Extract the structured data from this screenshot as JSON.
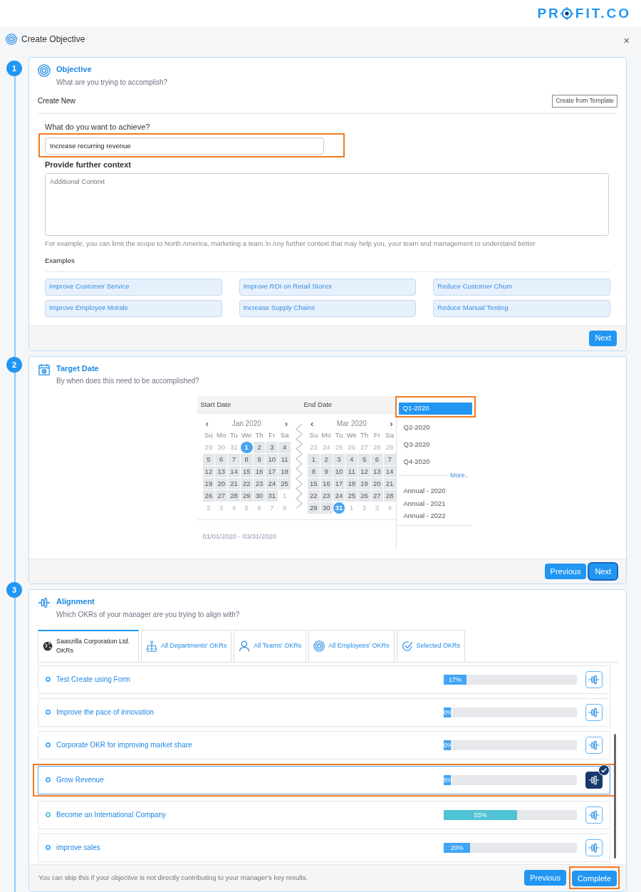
{
  "logo": {
    "before": "PR",
    "after": "FIT.CO"
  },
  "dialog": {
    "title": "Create Objective",
    "close": "×"
  },
  "objective": {
    "step": "1",
    "title": "Objective",
    "subtitle": "What are you trying to accomplish?",
    "create_new": "Create New",
    "template_button": "Create from Template",
    "goal_label": "What do you want to achieve?",
    "goal_value": "Increase recurring revenue",
    "goal_highlighted": true,
    "context_label": "Provide further context",
    "context_placeholder": "Additional Context",
    "hint": "For example, you can limit the scope to North America, marketing a team.\\n Any further context that may help you, your team and management to understand better",
    "examples_label": "Examples",
    "examples": [
      "Improve Customer Service",
      "Improve ROI on Retail Stores",
      "Reduce Customer Churn",
      "Improve Employee Morale",
      "Increase Supply Chains",
      "Reduce Manual Testing"
    ],
    "next": "Next"
  },
  "target_date": {
    "step": "2",
    "title": "Target Date",
    "subtitle": "By when does this need to be accomplished?",
    "start_label": "Start Date",
    "end_label": "End Date",
    "months": [
      {
        "title": "Jan 2020",
        "prev": "‹",
        "next": "›",
        "weekdays": [
          "Su",
          "Mo",
          "Tu",
          "We",
          "Th",
          "Fr",
          "Sa"
        ],
        "weeks": [
          [
            {
              "d": "29",
              "kind": "out"
            },
            {
              "d": "30",
              "kind": "out"
            },
            {
              "d": "31",
              "kind": "out"
            },
            {
              "d": "1",
              "kind": "selected"
            },
            {
              "d": "2",
              "kind": "range"
            },
            {
              "d": "3",
              "kind": "range"
            },
            {
              "d": "4",
              "kind": "range"
            }
          ],
          [
            {
              "d": "5",
              "kind": "range"
            },
            {
              "d": "6",
              "kind": "range"
            },
            {
              "d": "7",
              "kind": "range"
            },
            {
              "d": "8",
              "kind": "range"
            },
            {
              "d": "9",
              "kind": "range"
            },
            {
              "d": "10",
              "kind": "range"
            },
            {
              "d": "11",
              "kind": "range"
            }
          ],
          [
            {
              "d": "12",
              "kind": "range"
            },
            {
              "d": "13",
              "kind": "range"
            },
            {
              "d": "14",
              "kind": "range"
            },
            {
              "d": "15",
              "kind": "range"
            },
            {
              "d": "16",
              "kind": "range"
            },
            {
              "d": "17",
              "kind": "range"
            },
            {
              "d": "18",
              "kind": "range"
            }
          ],
          [
            {
              "d": "19",
              "kind": "range"
            },
            {
              "d": "20",
              "kind": "range"
            },
            {
              "d": "21",
              "kind": "range"
            },
            {
              "d": "22",
              "kind": "range"
            },
            {
              "d": "23",
              "kind": "range"
            },
            {
              "d": "24",
              "kind": "range"
            },
            {
              "d": "25",
              "kind": "range"
            }
          ],
          [
            {
              "d": "26",
              "kind": "range"
            },
            {
              "d": "27",
              "kind": "range"
            },
            {
              "d": "28",
              "kind": "range"
            },
            {
              "d": "29",
              "kind": "range"
            },
            {
              "d": "30",
              "kind": "range"
            },
            {
              "d": "31",
              "kind": "range"
            },
            {
              "d": "1",
              "kind": "out"
            }
          ],
          [
            {
              "d": "2",
              "kind": "out"
            },
            {
              "d": "3",
              "kind": "out"
            },
            {
              "d": "4",
              "kind": "out"
            },
            {
              "d": "5",
              "kind": "out"
            },
            {
              "d": "6",
              "kind": "out"
            },
            {
              "d": "7",
              "kind": "out"
            },
            {
              "d": "8",
              "kind": "out"
            }
          ]
        ]
      },
      {
        "title": "Mar 2020",
        "prev": "‹",
        "next": "›",
        "weekdays": [
          "Su",
          "Mo",
          "Tu",
          "We",
          "Th",
          "Fr",
          "Sa"
        ],
        "weeks": [
          [
            {
              "d": "23",
              "kind": "out"
            },
            {
              "d": "24",
              "kind": "out"
            },
            {
              "d": "25",
              "kind": "out"
            },
            {
              "d": "26",
              "kind": "out"
            },
            {
              "d": "27",
              "kind": "out"
            },
            {
              "d": "28",
              "kind": "out"
            },
            {
              "d": "29",
              "kind": "out"
            }
          ],
          [
            {
              "d": "1",
              "kind": "range"
            },
            {
              "d": "2",
              "kind": "range"
            },
            {
              "d": "3",
              "kind": "range"
            },
            {
              "d": "4",
              "kind": "range"
            },
            {
              "d": "5",
              "kind": "range"
            },
            {
              "d": "6",
              "kind": "range"
            },
            {
              "d": "7",
              "kind": "range"
            }
          ],
          [
            {
              "d": "8",
              "kind": "range"
            },
            {
              "d": "9",
              "kind": "range"
            },
            {
              "d": "10",
              "kind": "range"
            },
            {
              "d": "11",
              "kind": "range"
            },
            {
              "d": "12",
              "kind": "range"
            },
            {
              "d": "13",
              "kind": "range"
            },
            {
              "d": "14",
              "kind": "range"
            }
          ],
          [
            {
              "d": "15",
              "kind": "range"
            },
            {
              "d": "16",
              "kind": "range"
            },
            {
              "d": "17",
              "kind": "range"
            },
            {
              "d": "18",
              "kind": "range"
            },
            {
              "d": "19",
              "kind": "range"
            },
            {
              "d": "20",
              "kind": "range"
            },
            {
              "d": "21",
              "kind": "range"
            }
          ],
          [
            {
              "d": "22",
              "kind": "range"
            },
            {
              "d": "23",
              "kind": "range"
            },
            {
              "d": "24",
              "kind": "range"
            },
            {
              "d": "25",
              "kind": "range"
            },
            {
              "d": "26",
              "kind": "range"
            },
            {
              "d": "27",
              "kind": "range"
            },
            {
              "d": "28",
              "kind": "range"
            }
          ],
          [
            {
              "d": "29",
              "kind": "range"
            },
            {
              "d": "30",
              "kind": "range"
            },
            {
              "d": "31",
              "kind": "selected"
            },
            {
              "d": "1",
              "kind": "out"
            },
            {
              "d": "2",
              "kind": "out"
            },
            {
              "d": "3",
              "kind": "out"
            },
            {
              "d": "4",
              "kind": "out"
            }
          ]
        ]
      }
    ],
    "range_text": "01/01/2020 - 03/31/2020",
    "quarters": [
      {
        "label": "Q1-2020",
        "selected": true,
        "highlighted": true
      },
      {
        "label": "Q2-2020",
        "selected": false,
        "highlighted": false
      },
      {
        "label": "Q3-2020",
        "selected": false,
        "highlighted": false
      },
      {
        "label": "Q4-2020",
        "selected": false,
        "highlighted": false
      }
    ],
    "more": "More..",
    "annuals": [
      {
        "label": "Annual - 2020",
        "selected": false
      },
      {
        "label": "Annual - 2021",
        "selected": false
      },
      {
        "label": "Annual - 2022",
        "selected": false
      }
    ],
    "previous": "Previous",
    "next": "Next"
  },
  "alignment": {
    "step": "3",
    "title": "Alignment",
    "subtitle": "Which OKRs of your manager are you trying to align with?",
    "tabs": [
      {
        "label": "Saaszilla Corporation Ltd. OKRs",
        "selected": true
      },
      {
        "label": "All Departments' OKRs",
        "selected": false
      },
      {
        "label": "All Teams' OKRs",
        "selected": false
      },
      {
        "label": "All Employees' OKRs",
        "selected": false
      },
      {
        "label": "Selected OKRs",
        "selected": false
      }
    ],
    "okrs": [
      {
        "name": "Test Create using Form",
        "level": 0.17,
        "progress": "17%",
        "color": "#42a5f5",
        "selected": false
      },
      {
        "name": "Improve the pace of innovation",
        "level": 0,
        "progress": "0%",
        "color": "#42a5f5",
        "selected": false
      },
      {
        "name": "Corporate OKR for improving market share",
        "level": 0,
        "progress": "0%",
        "color": "#42a5f5",
        "selected": false
      },
      {
        "name": "Grow Revenue",
        "level": 0.05,
        "progress": "5%",
        "color": "#42a5f5",
        "selected": true
      },
      {
        "name": "Become an International Company",
        "level": 0.55,
        "progress": "55%",
        "color": "#4fc3d4",
        "selected": false
      },
      {
        "name": "improve sales",
        "level": 0.2,
        "progress": "20%",
        "color": "#42a5f5",
        "selected": false
      }
    ],
    "skip_note": "You can skip this if your objective is not directly contributing to your manager's key results.",
    "previous": "Previous",
    "complete": "Complete",
    "complete_highlighted": true
  }
}
